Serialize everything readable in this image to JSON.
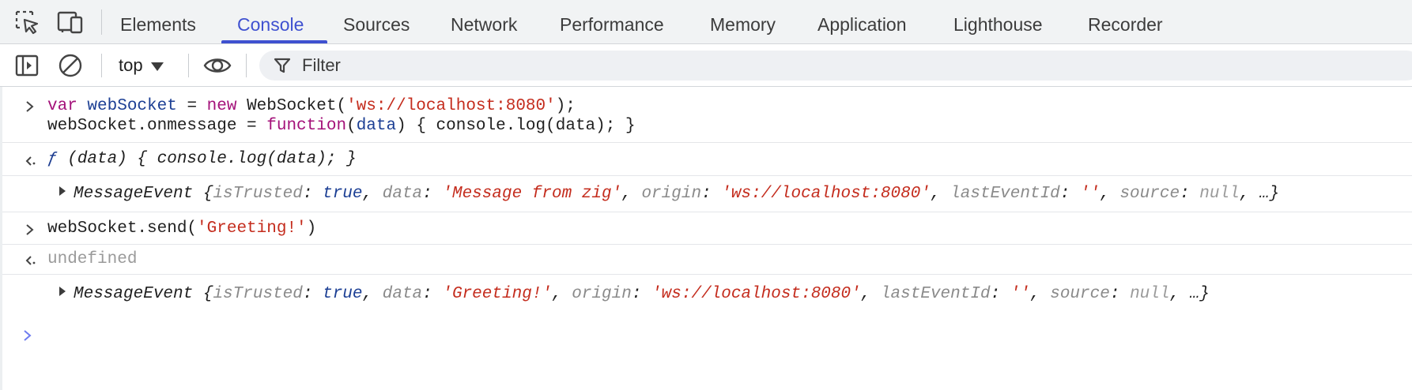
{
  "tabs": [
    "Elements",
    "Console",
    "Sources",
    "Network",
    "Performance",
    "Memory",
    "Application",
    "Lighthouse",
    "Recorder"
  ],
  "active_tab": "Console",
  "toolbar": {
    "context": "top",
    "filter_placeholder": "Filter"
  },
  "icons": {
    "inspect": "inspect-element-icon",
    "device": "device-toolbar-icon",
    "sidebar": "show-sidebar-icon",
    "clear": "clear-console-icon",
    "eye": "live-expression-icon",
    "filter": "filter-icon"
  },
  "colors": {
    "accent": "#3f51d0",
    "keyword": "#a4127a",
    "variable": "#1c3f94",
    "string": "#c42c1d",
    "muted": "#9a9a9a"
  },
  "console": {
    "input1": {
      "line1": {
        "kw1": "var",
        "var1": "webSocket",
        "eq": " = ",
        "kw2": "new",
        "cls": " WebSocket(",
        "str": "'ws://localhost:8080'",
        "end": ");"
      },
      "line2": {
        "pre": "webSocket.onmessage = ",
        "kw": "function",
        "paren_open": "(",
        "param": "data",
        "rest": ") { console.log(data); }"
      }
    },
    "result1": {
      "f": "ƒ",
      "rest": " (data) { console.log(data); }"
    },
    "log1": {
      "name": "MessageEvent",
      "open": " {",
      "k1": "isTrusted",
      "v1": "true",
      "k2": "data",
      "v2": "'Message from zig'",
      "k3": "origin",
      "v3": "'ws://localhost:8080'",
      "k4": "lastEventId",
      "v4": "''",
      "k5": "source",
      "v5": "null",
      "tail": ", …}"
    },
    "input2": {
      "pre": "webSocket.send(",
      "str": "'Greeting!'",
      "end": ")"
    },
    "result2": "undefined",
    "log2": {
      "name": "MessageEvent",
      "open": " {",
      "k1": "isTrusted",
      "v1": "true",
      "k2": "data",
      "v2": "'Greeting!'",
      "k3": "origin",
      "v3": "'ws://localhost:8080'",
      "k4": "lastEventId",
      "v4": "''",
      "k5": "source",
      "v5": "null",
      "tail": ", …}"
    }
  }
}
